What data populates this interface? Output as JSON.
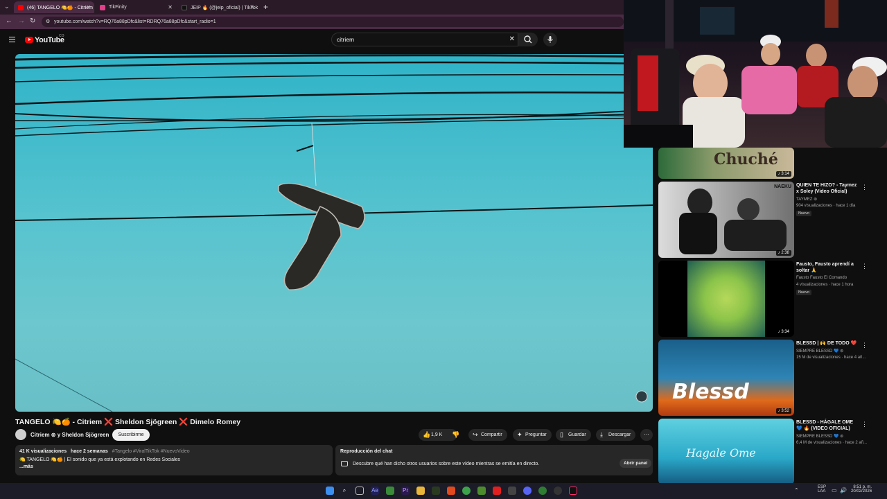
{
  "browser": {
    "tabs": [
      {
        "label": "(46) TANGELO 🍋🍊 - Citriem ⊗",
        "active": true
      },
      {
        "label": "TikFinity",
        "active": false
      },
      {
        "label": "JEIP 🔥 (@jeip_oficial) | TikTok",
        "active": false
      }
    ],
    "url": "youtube.com/watch?v=RQ76a88pDfc&list=RDRQ76a88pDfc&start_radio=1"
  },
  "youtube": {
    "logo": "YouTube",
    "country": "CO",
    "search_value": "citriem"
  },
  "video": {
    "title": "TANGELO 🍋🍊 - Citriem ❌ Sheldon Sjögreen ❌ Dimelo Romey",
    "channel": "Citriem ⊚ y Sheldon Sjögreen",
    "subscribe_label": "Suscribirme",
    "likes": "1,9 K",
    "share_label": "Compartir",
    "ask_label": "Preguntar",
    "save_label": "Guardar",
    "download_label": "Descargar",
    "description": {
      "views": "41 K visualizaciones",
      "date": "hace 2 semanas",
      "hashtags": "#Tangelo #ViralTikTok #NuevoVideo",
      "line": "🍋 TANGELO 🍋🍊 | El sonido que ya está explotando en Redes Sociales",
      "more": "...más"
    },
    "chat": {
      "title": "Reproducción del chat",
      "text": "Descubre qué han dicho otros usuarios sobre este vídeo mientras se emitía en directo.",
      "open_label": "Abrir panel"
    }
  },
  "sidebar": {
    "items": [
      {
        "title": "",
        "channel": "",
        "meta": "",
        "badge": "",
        "duration": "3:14",
        "thumb_text": "Chuché"
      },
      {
        "title": "QUIEN TE HIZO? - Taymez x Soley (Video Oficial)",
        "channel": "TAYMEZ ⊚",
        "meta": "904 visualizaciones · hace 1 día",
        "badge": "Nuevo",
        "duration": "2:38",
        "thumb_text": "NAEKU"
      },
      {
        "title": "Fausto, Fausto aprendí a soltar 🙏",
        "channel": "Fausto Fausto El Comando",
        "meta": "4 visualizaciones · hace 1 hora",
        "badge": "Nuevo",
        "duration": "3:34",
        "thumb_text": ""
      },
      {
        "title": "BLESSD | 🙌 DE TODO ❤️",
        "channel": "SIEMPRE BLESSD 💙 ⊚",
        "meta": "15 M de visualizaciones · hace 4 añ...",
        "badge": "",
        "duration": "3:52",
        "thumb_text": "Blessd"
      },
      {
        "title": "BLESSD - HÁGALE OME 💙 🔥 (VIDEO OFICIAL)",
        "channel": "SIEMPRE BLESSD 💙 ⊚",
        "meta": "6,4 M de visualizaciones · hace 2 añ...",
        "badge": "",
        "duration": "",
        "thumb_text": "Hagale Ome"
      }
    ]
  },
  "taskbar": {
    "lang": "ESP",
    "lang2": "LAA",
    "time": "8:51 p. m.",
    "date": "20/02/2026"
  }
}
